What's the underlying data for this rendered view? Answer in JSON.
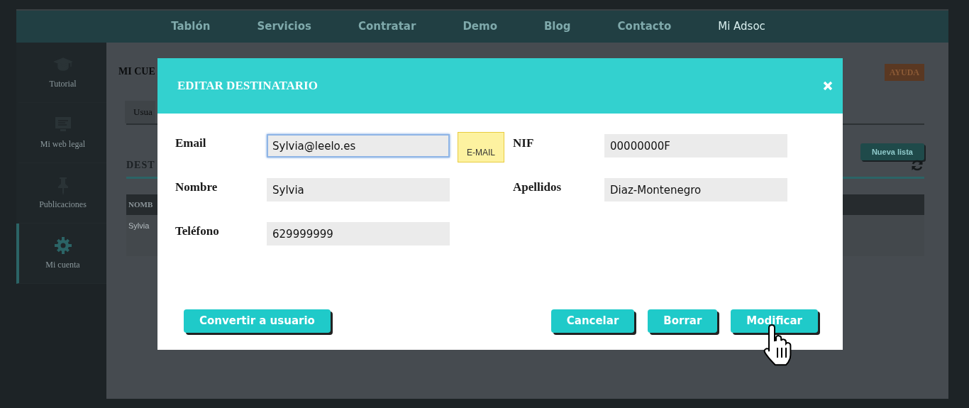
{
  "navbar": {
    "items": [
      {
        "label": "Tablón",
        "selected": false
      },
      {
        "label": "Servicios",
        "selected": false
      },
      {
        "label": "Contratar",
        "selected": false
      },
      {
        "label": "Demo",
        "selected": false
      },
      {
        "label": "Blog",
        "selected": false
      },
      {
        "label": "Contacto",
        "selected": false
      },
      {
        "label": "Mi Adsoc",
        "selected": true
      }
    ]
  },
  "sidebar": {
    "items": [
      {
        "label": "Tutorial",
        "kind": "cap",
        "selected": false
      },
      {
        "label": "Mi web legal",
        "kind": "monitor",
        "selected": false
      },
      {
        "label": "Publicaciones",
        "kind": "pin",
        "selected": false
      },
      {
        "label": "Mi cuenta",
        "kind": "gear",
        "selected": true
      }
    ]
  },
  "background": {
    "page_title": "MI CUE",
    "help_button": "AYUDA",
    "tab": "Usua",
    "section_title": "DEST",
    "new_list_button": "Nueva lista",
    "table": {
      "columns": [
        "NOMB"
      ],
      "rows": [
        [
          "Sylvia"
        ]
      ]
    }
  },
  "modal": {
    "title": "EDITAR DESTINATARIO",
    "fields": [
      {
        "label": "Email",
        "value": "Sylvia@leelo.es",
        "focused": true,
        "tooltip": "E-MAIL"
      },
      {
        "label": "NIF",
        "value": "00000000F",
        "focused": false
      },
      {
        "label": "Nombre",
        "value": "Sylvia",
        "focused": false
      },
      {
        "label": "Apellidos",
        "value": "Diaz-Montenegro",
        "focused": false
      },
      {
        "label": "Teléfono",
        "value": "629999999",
        "focused": false
      }
    ],
    "left_buttons": [
      "Convertir a usuario"
    ],
    "right_buttons": [
      "Cancelar",
      "Borrar",
      "Modificar"
    ]
  }
}
